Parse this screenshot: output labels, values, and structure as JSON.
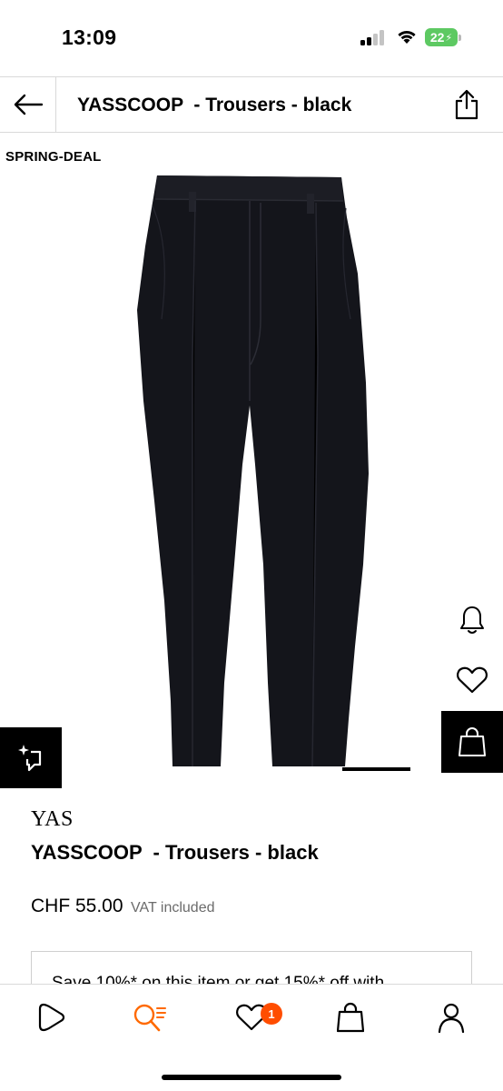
{
  "status_bar": {
    "time": "13:09",
    "battery_level": "22",
    "battery_color": "#5dc962",
    "icons": [
      "signal-icon",
      "wifi-icon",
      "battery-icon"
    ]
  },
  "header": {
    "title": "YASSCOOP  - Trousers - black",
    "back_icon": "arrow-left-icon",
    "share_icon": "share-icon"
  },
  "gallery": {
    "deal_badge": "SPRING-DEAL",
    "image_subject": "black tailored trousers",
    "active_slide": 1
  },
  "actions": {
    "bell_icon": "bell-icon",
    "wishlist_icon": "heart-icon",
    "add_to_bag_icon": "shopping-bag-icon",
    "similar_items_icon": "sparkle-crop-icon"
  },
  "product": {
    "brand": "YAS",
    "name": "YASSCOOP  - Trousers - black",
    "price": "CHF 55.00",
    "vat_note": "VAT included"
  },
  "promo": {
    "text": "Save 10%* on this item or get 15%* off with"
  },
  "bottom_nav": {
    "items": [
      {
        "icon": "play-home-icon",
        "active": false
      },
      {
        "icon": "search-icon",
        "active": true
      },
      {
        "icon": "heart-icon",
        "active": false,
        "badge": "1"
      },
      {
        "icon": "shopping-bag-icon",
        "active": false
      },
      {
        "icon": "profile-icon",
        "active": false
      }
    ],
    "accent_color": "#ff6900",
    "badge_color": "#ff4d00"
  }
}
